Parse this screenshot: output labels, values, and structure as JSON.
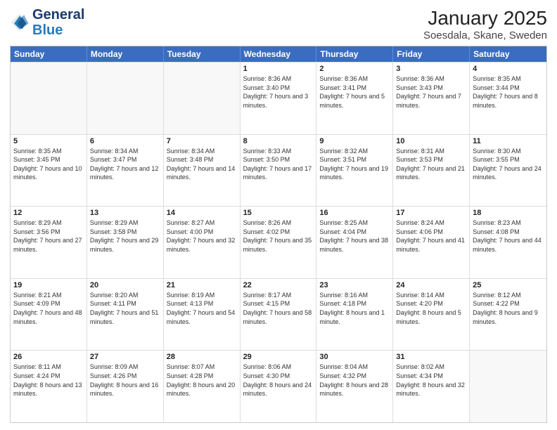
{
  "logo": {
    "line1": "General",
    "line2": "Blue"
  },
  "title": "January 2025",
  "subtitle": "Soesdala, Skane, Sweden",
  "weekdays": [
    "Sunday",
    "Monday",
    "Tuesday",
    "Wednesday",
    "Thursday",
    "Friday",
    "Saturday"
  ],
  "rows": [
    [
      {
        "day": "",
        "info": ""
      },
      {
        "day": "",
        "info": ""
      },
      {
        "day": "",
        "info": ""
      },
      {
        "day": "1",
        "info": "Sunrise: 8:36 AM\nSunset: 3:40 PM\nDaylight: 7 hours and 3 minutes."
      },
      {
        "day": "2",
        "info": "Sunrise: 8:36 AM\nSunset: 3:41 PM\nDaylight: 7 hours and 5 minutes."
      },
      {
        "day": "3",
        "info": "Sunrise: 8:36 AM\nSunset: 3:43 PM\nDaylight: 7 hours and 7 minutes."
      },
      {
        "day": "4",
        "info": "Sunrise: 8:35 AM\nSunset: 3:44 PM\nDaylight: 7 hours and 8 minutes."
      }
    ],
    [
      {
        "day": "5",
        "info": "Sunrise: 8:35 AM\nSunset: 3:45 PM\nDaylight: 7 hours and 10 minutes."
      },
      {
        "day": "6",
        "info": "Sunrise: 8:34 AM\nSunset: 3:47 PM\nDaylight: 7 hours and 12 minutes."
      },
      {
        "day": "7",
        "info": "Sunrise: 8:34 AM\nSunset: 3:48 PM\nDaylight: 7 hours and 14 minutes."
      },
      {
        "day": "8",
        "info": "Sunrise: 8:33 AM\nSunset: 3:50 PM\nDaylight: 7 hours and 17 minutes."
      },
      {
        "day": "9",
        "info": "Sunrise: 8:32 AM\nSunset: 3:51 PM\nDaylight: 7 hours and 19 minutes."
      },
      {
        "day": "10",
        "info": "Sunrise: 8:31 AM\nSunset: 3:53 PM\nDaylight: 7 hours and 21 minutes."
      },
      {
        "day": "11",
        "info": "Sunrise: 8:30 AM\nSunset: 3:55 PM\nDaylight: 7 hours and 24 minutes."
      }
    ],
    [
      {
        "day": "12",
        "info": "Sunrise: 8:29 AM\nSunset: 3:56 PM\nDaylight: 7 hours and 27 minutes."
      },
      {
        "day": "13",
        "info": "Sunrise: 8:29 AM\nSunset: 3:58 PM\nDaylight: 7 hours and 29 minutes."
      },
      {
        "day": "14",
        "info": "Sunrise: 8:27 AM\nSunset: 4:00 PM\nDaylight: 7 hours and 32 minutes."
      },
      {
        "day": "15",
        "info": "Sunrise: 8:26 AM\nSunset: 4:02 PM\nDaylight: 7 hours and 35 minutes."
      },
      {
        "day": "16",
        "info": "Sunrise: 8:25 AM\nSunset: 4:04 PM\nDaylight: 7 hours and 38 minutes."
      },
      {
        "day": "17",
        "info": "Sunrise: 8:24 AM\nSunset: 4:06 PM\nDaylight: 7 hours and 41 minutes."
      },
      {
        "day": "18",
        "info": "Sunrise: 8:23 AM\nSunset: 4:08 PM\nDaylight: 7 hours and 44 minutes."
      }
    ],
    [
      {
        "day": "19",
        "info": "Sunrise: 8:21 AM\nSunset: 4:09 PM\nDaylight: 7 hours and 48 minutes."
      },
      {
        "day": "20",
        "info": "Sunrise: 8:20 AM\nSunset: 4:11 PM\nDaylight: 7 hours and 51 minutes."
      },
      {
        "day": "21",
        "info": "Sunrise: 8:19 AM\nSunset: 4:13 PM\nDaylight: 7 hours and 54 minutes."
      },
      {
        "day": "22",
        "info": "Sunrise: 8:17 AM\nSunset: 4:15 PM\nDaylight: 7 hours and 58 minutes."
      },
      {
        "day": "23",
        "info": "Sunrise: 8:16 AM\nSunset: 4:18 PM\nDaylight: 8 hours and 1 minute."
      },
      {
        "day": "24",
        "info": "Sunrise: 8:14 AM\nSunset: 4:20 PM\nDaylight: 8 hours and 5 minutes."
      },
      {
        "day": "25",
        "info": "Sunrise: 8:12 AM\nSunset: 4:22 PM\nDaylight: 8 hours and 9 minutes."
      }
    ],
    [
      {
        "day": "26",
        "info": "Sunrise: 8:11 AM\nSunset: 4:24 PM\nDaylight: 8 hours and 13 minutes."
      },
      {
        "day": "27",
        "info": "Sunrise: 8:09 AM\nSunset: 4:26 PM\nDaylight: 8 hours and 16 minutes."
      },
      {
        "day": "28",
        "info": "Sunrise: 8:07 AM\nSunset: 4:28 PM\nDaylight: 8 hours and 20 minutes."
      },
      {
        "day": "29",
        "info": "Sunrise: 8:06 AM\nSunset: 4:30 PM\nDaylight: 8 hours and 24 minutes."
      },
      {
        "day": "30",
        "info": "Sunrise: 8:04 AM\nSunset: 4:32 PM\nDaylight: 8 hours and 28 minutes."
      },
      {
        "day": "31",
        "info": "Sunrise: 8:02 AM\nSunset: 4:34 PM\nDaylight: 8 hours and 32 minutes."
      },
      {
        "day": "",
        "info": ""
      }
    ]
  ]
}
